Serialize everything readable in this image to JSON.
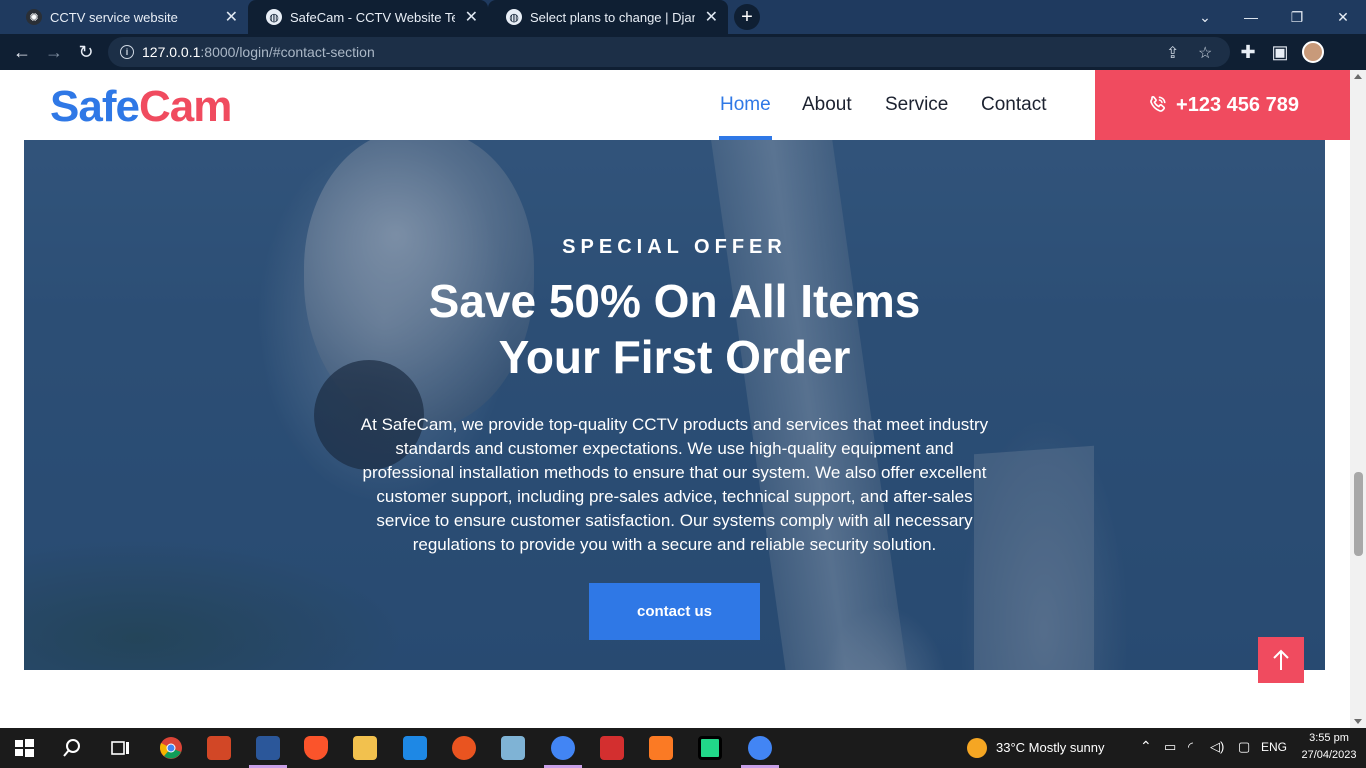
{
  "browser": {
    "tabs": [
      {
        "title": "CCTV service website",
        "icon": "chatgpt-icon"
      },
      {
        "title": "SafeCam - CCTV Website Templat",
        "icon": "globe-icon"
      },
      {
        "title": "Select plans to change | Django s",
        "icon": "globe-icon"
      }
    ],
    "new_tab_label": "+",
    "url_host": "127.0.0.1",
    "url_rest": ":8000/login/#contact-section"
  },
  "site": {
    "logo_part1": "Safe",
    "logo_part2": "Cam",
    "nav": [
      "Home",
      "About",
      "Service",
      "Contact"
    ],
    "active_nav": "Home",
    "phone": "+123 456 789"
  },
  "hero": {
    "eyebrow": "SPECIAL OFFER",
    "headline_line1": "Save 50% On All Items",
    "headline_line2": "Your First Order",
    "description": "At SafeCam, we provide top-quality CCTV products and services that meet industry standards and customer expectations. We use high-quality equipment and professional installation methods to ensure that our system. We also offer excellent customer support, including pre-sales advice, technical support, and after-sales service to ensure customer satisfaction. Our systems comply with all necessary regulations to provide you with a secure and reliable security solution.",
    "cta": "contact us"
  },
  "colors": {
    "brand_blue": "#2f78e6",
    "brand_red": "#f04b5f"
  },
  "taskbar": {
    "weather": "33°C  Mostly sunny",
    "language": "ENG",
    "time": "3:55 pm",
    "date": "27/04/2023",
    "apps": [
      "windows-start-icon",
      "search-icon",
      "task-view-icon",
      "chrome-icon",
      "powerpoint-icon",
      "word-icon",
      "brave-icon",
      "file-explorer-icon",
      "vscode-icon",
      "ubuntu-icon",
      "notepad-icon",
      "chrome-profile-icon",
      "wps-icon",
      "xampp-icon",
      "pycharm-icon",
      "chrome-profile-2-icon"
    ]
  }
}
